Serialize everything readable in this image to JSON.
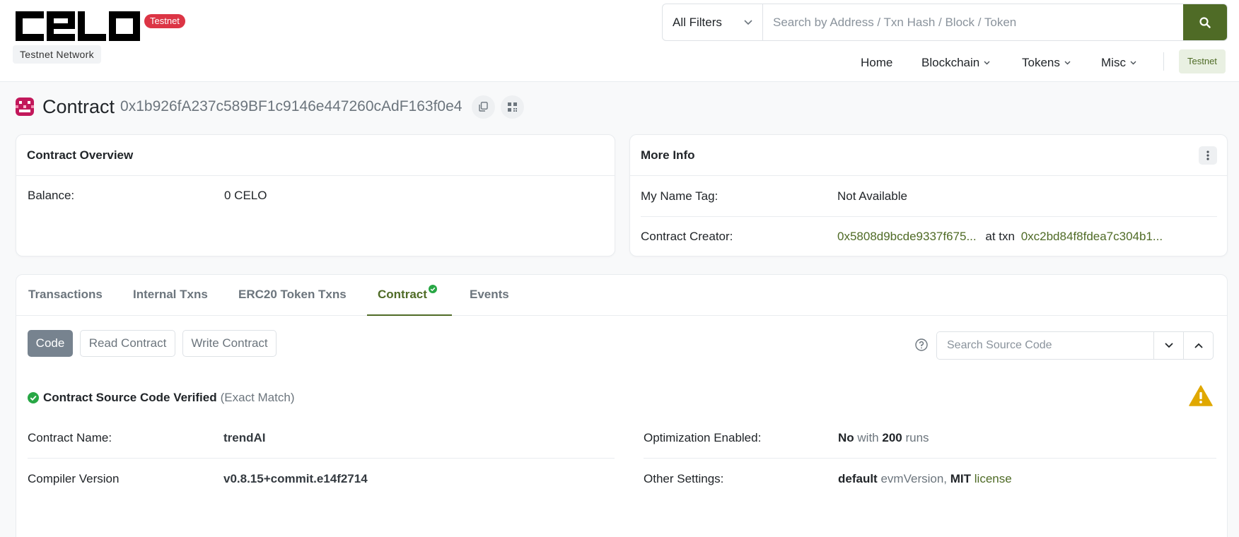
{
  "header": {
    "logo_text": "CELO",
    "network_badge": "Testnet",
    "network_label": "Testnet Network",
    "search": {
      "filter_label": "All Filters",
      "placeholder": "Search by Address / Txn Hash / Block / Token"
    },
    "nav": {
      "home": "Home",
      "blockchain": "Blockchain",
      "tokens": "Tokens",
      "misc": "Misc",
      "network_button": "Testnet"
    }
  },
  "title": {
    "label": "Contract",
    "address": "0x1b926fA237c589BF1c9146e447260cAdF163f0e4"
  },
  "overview": {
    "heading": "Contract Overview",
    "balance_label": "Balance:",
    "balance_value": "0 CELO"
  },
  "more_info": {
    "heading": "More Info",
    "name_tag_label": "My Name Tag:",
    "name_tag_value": "Not Available",
    "creator_label": "Contract Creator:",
    "creator_address": "0x5808d9bcde9337f675...",
    "at_txn": "at txn",
    "creator_txn": "0xc2bd84f8fdea7c304b1..."
  },
  "tabs": [
    "Transactions",
    "Internal Txns",
    "ERC20 Token Txns",
    "Contract",
    "Events"
  ],
  "contract_buttons": {
    "code": "Code",
    "read": "Read Contract",
    "write": "Write Contract"
  },
  "source_search": {
    "placeholder": "Search Source Code"
  },
  "verification": {
    "title": "Contract Source Code Verified",
    "note": "(Exact Match)"
  },
  "details": {
    "name_label": "Contract Name:",
    "name_value": "trendAI",
    "compiler_label": "Compiler Version",
    "compiler_value": "v0.8.15+commit.e14f2714",
    "optimization_label": "Optimization Enabled:",
    "optimization_value": "No",
    "with": "with",
    "runs_value": "200",
    "runs": "runs",
    "settings_label": "Other Settings:",
    "settings_default": "default",
    "settings_evm": "evmVersion,",
    "settings_license_type": "MIT",
    "settings_license": "license"
  },
  "colors": {
    "accent": "#4f6b26",
    "badge_red": "#dc3545",
    "verified_green": "#28a745",
    "warning": "#e0a800"
  }
}
